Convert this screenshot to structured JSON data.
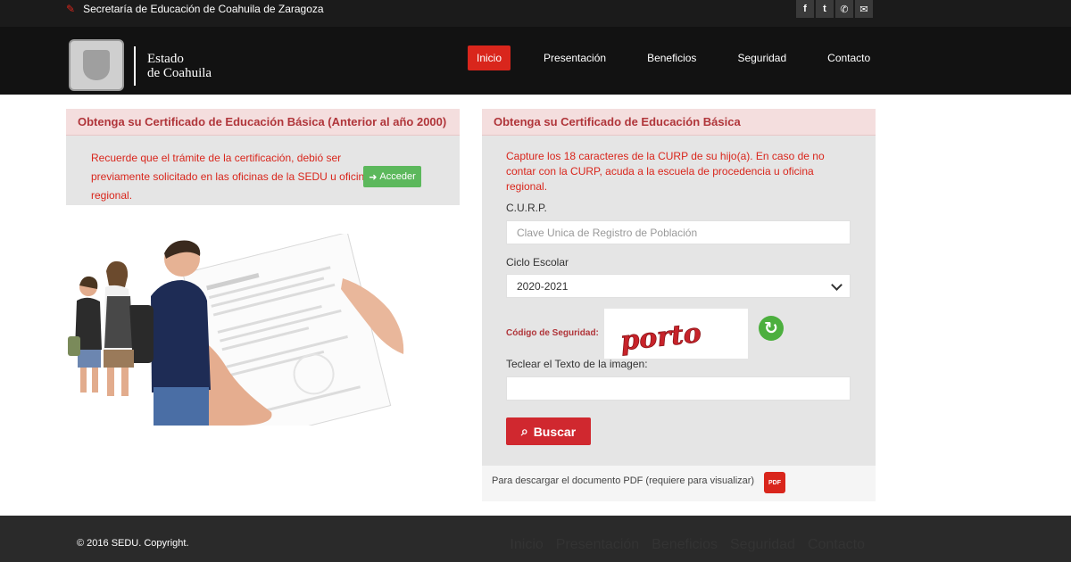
{
  "topbar": {
    "org_name": "Secretaría de Educación de Coahuila de Zaragoza",
    "social": [
      {
        "icon": "facebook-icon",
        "glyph": "f"
      },
      {
        "icon": "twitter-icon",
        "glyph": "t"
      },
      {
        "icon": "phone-icon",
        "glyph": "✆"
      },
      {
        "icon": "mail-icon",
        "glyph": "✉"
      }
    ]
  },
  "header": {
    "logo_line1": "Estado",
    "logo_line2": "de Coahuila",
    "nav": [
      "Inicio",
      "Presentación",
      "Beneficios",
      "Seguridad",
      "Contacto"
    ]
  },
  "left_panel": {
    "title": "Obtenga su Certificado de Educación Básica (Anterior al año 2000)",
    "message": "Recuerde que el trámite de la certificación, debió ser previamente solicitado en las oficinas de la SEDU u oficina regional.",
    "button_label": "Acceder"
  },
  "right_panel": {
    "title": "Obtenga su Certificado de Educación Básica",
    "message": "Capture los 18 caracteres de la CURP de su hijo(a). En caso de no contar con la CURP, acuda a la escuela de procedencia u oficina regional.",
    "curp_label": "C.U.R.P.",
    "curp_placeholder": "Clave Unica de Registro de Población",
    "ciclo_label": "Ciclo Escolar",
    "ciclo_value": "2020-2021",
    "codigo_label": "Código de Seguridad:",
    "captcha_text": "porto",
    "teclear_label": "Teclear el Texto de la imagen:",
    "teclear_value": "",
    "search_label": "Buscar"
  },
  "pdf": {
    "text": "Para descargar el documento PDF (requiere para visualizar)",
    "icon_label": "PDF"
  },
  "footer": {
    "copyright": "© 2016 SEDU. Copyright.",
    "nav": [
      "Inicio",
      "Presentación",
      "Beneficios",
      "Seguridad",
      "Contacto"
    ]
  },
  "colors": {
    "accent": "#d9261c",
    "header_bg": "#121212",
    "panel_bg": "#e5e5e5",
    "panel_head": "#f4dede",
    "green": "#5cb85c"
  }
}
